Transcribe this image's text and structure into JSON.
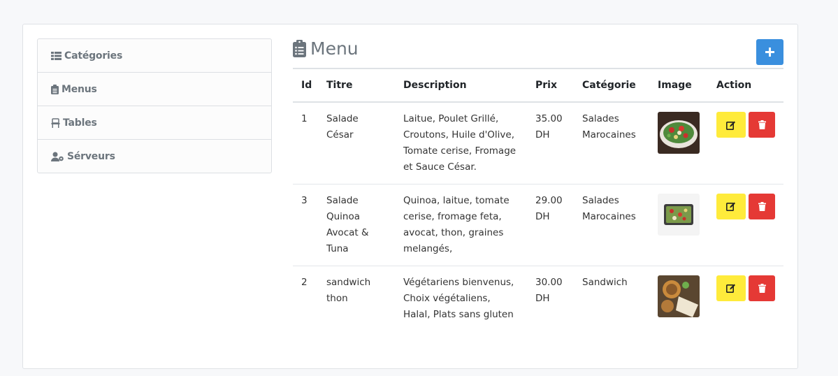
{
  "sidebar": {
    "items": [
      {
        "label": "Catégories",
        "icon": "list-icon"
      },
      {
        "label": "Menus",
        "icon": "clipboard-icon"
      },
      {
        "label": "Tables",
        "icon": "chair-icon"
      },
      {
        "label": "Sérveurs",
        "icon": "users-cog-icon"
      }
    ]
  },
  "main": {
    "title": "Menu",
    "add_label": "+",
    "columns": [
      "Id",
      "Titre",
      "Description",
      "Prix",
      "Catégorie",
      "Image",
      "Action"
    ],
    "rows": [
      {
        "id": "1",
        "title": "Salade César",
        "description": "Laitue, Poulet Grillé, Croutons, Huile d'Olive, Tomate cerise, Fromage et Sauce César.",
        "price": "35.00 DH",
        "category": "Salades Marocaines",
        "image": "salad-photo"
      },
      {
        "id": "3",
        "title": "Salade Quinoa Avocat & Tuna",
        "description": "Quinoa, laitue, tomate cerise, fromage feta, avocat, thon, graines melangés,",
        "price": "29.00 DH",
        "category": "Salades Marocaines",
        "image": "quinoa-salad-photo"
      },
      {
        "id": "2",
        "title": "sandwich thon",
        "description": "Végétariens bienvenus, Choix végétaliens, Halal, Plats sans gluten",
        "price": "30.00 DH",
        "category": "Sandwich",
        "image": "sandwich-photo"
      }
    ]
  },
  "colors": {
    "add_button": "#3a8fde",
    "edit_button": "#ffeb3b",
    "delete_button": "#e53935",
    "muted_text": "#6c757d"
  }
}
